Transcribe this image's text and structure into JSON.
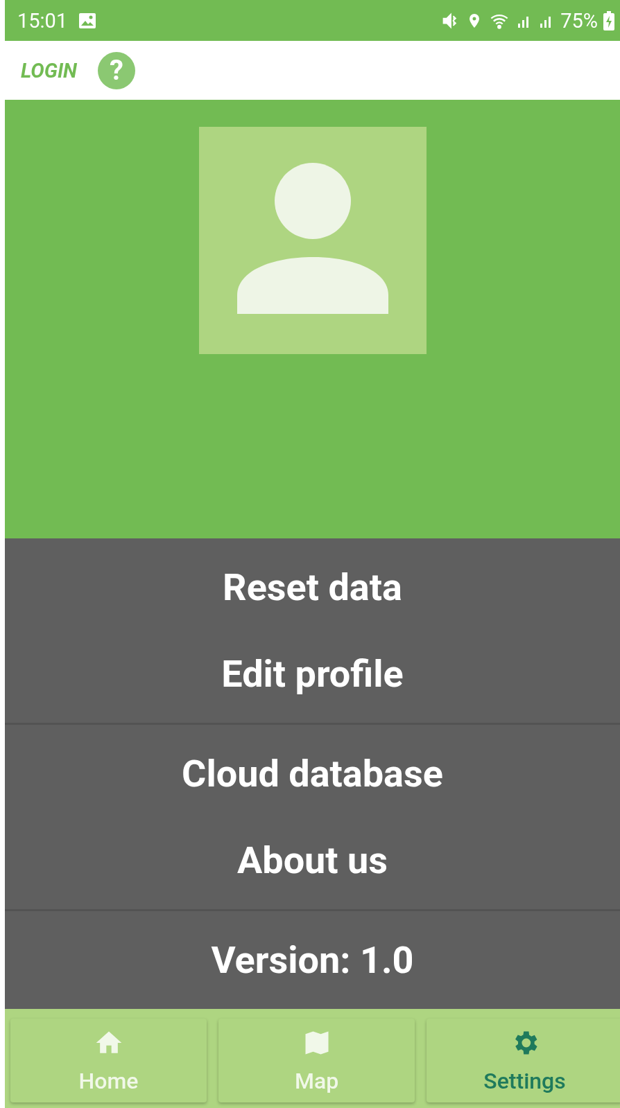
{
  "status_bar": {
    "time": "15:01",
    "battery": "75%"
  },
  "header": {
    "title": "LOGIN",
    "help": "?"
  },
  "profile": {
    "kind": "avatar"
  },
  "menu_groups": [
    {
      "items": [
        "Reset data",
        "Edit profile"
      ]
    },
    {
      "items": [
        "Cloud database",
        "About us"
      ]
    },
    {
      "items": [
        "Version: 1.0"
      ]
    }
  ],
  "nav": [
    {
      "label": "Home",
      "kind": "home",
      "selected": false
    },
    {
      "label": "Map",
      "kind": "map",
      "selected": false
    },
    {
      "label": "Settings",
      "kind": "settings",
      "selected": true
    }
  ]
}
